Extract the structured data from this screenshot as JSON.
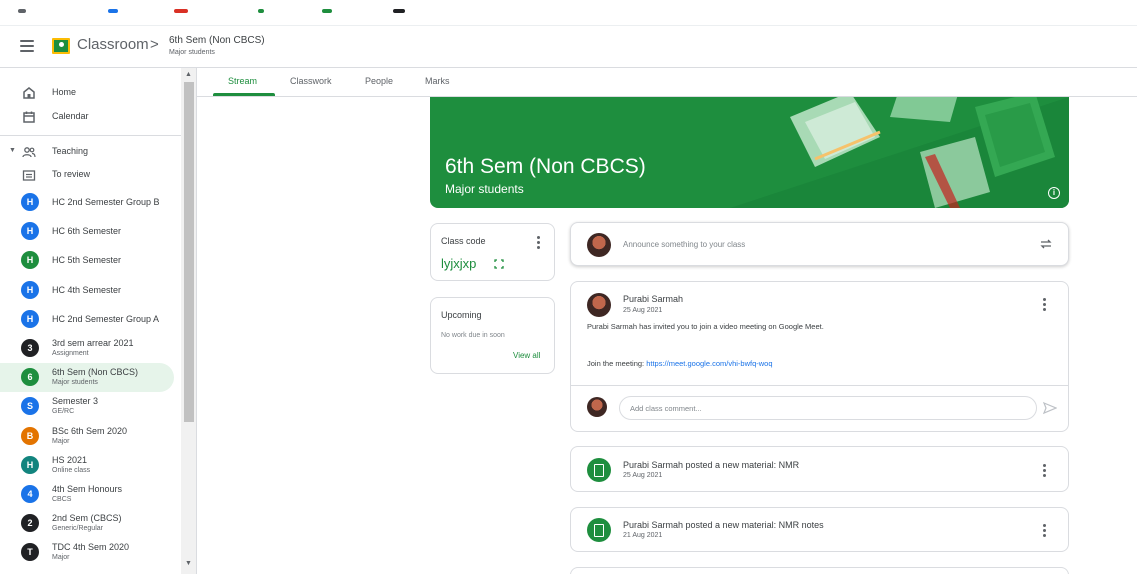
{
  "app": {
    "title": "Classroom"
  },
  "breadcrumb": {
    "separator": ">",
    "class_name": "6th Sem (Non CBCS)",
    "class_section": "Major students"
  },
  "sidebar": {
    "nav": [
      {
        "label": "Home",
        "icon": "home-icon"
      },
      {
        "label": "Calendar",
        "icon": "calendar-icon"
      }
    ],
    "teaching_label": "Teaching",
    "to_review_label": "To review",
    "classes": [
      {
        "avatar": "H",
        "name": "HC 2nd Semester Group B",
        "sub": "",
        "color": "#1a73e8"
      },
      {
        "avatar": "H",
        "name": "HC 6th Semester",
        "sub": "",
        "color": "#1a73e8"
      },
      {
        "avatar": "H",
        "name": "HC 5th Semester",
        "sub": "",
        "color": "#1e8e3e"
      },
      {
        "avatar": "H",
        "name": "HC 4th Semester",
        "sub": "",
        "color": "#1a73e8"
      },
      {
        "avatar": "H",
        "name": "HC 2nd Semester Group A",
        "sub": "",
        "color": "#1a73e8"
      },
      {
        "avatar": "3",
        "name": "3rd sem arrear 2021",
        "sub": "Assignment",
        "color": "#202124"
      },
      {
        "avatar": "6",
        "name": "6th Sem (Non CBCS)",
        "sub": "Major students",
        "color": "#1e8e3e"
      },
      {
        "avatar": "S",
        "name": "Semester 3",
        "sub": "GE/RC",
        "color": "#1a73e8"
      },
      {
        "avatar": "B",
        "name": "BSc 6th Sem 2020",
        "sub": "Major",
        "color": "#e37400"
      },
      {
        "avatar": "H",
        "name": "HS 2021",
        "sub": "Online class",
        "color": "#12847e"
      },
      {
        "avatar": "4",
        "name": "4th Sem Honours",
        "sub": "CBCS",
        "color": "#1a73e8"
      },
      {
        "avatar": "2",
        "name": "2nd Sem (CBCS)",
        "sub": "Generic/Regular",
        "color": "#202124"
      },
      {
        "avatar": "T",
        "name": "TDC 4th Sem 2020",
        "sub": "Major",
        "color": "#202124"
      }
    ]
  },
  "tabs": [
    "Stream",
    "Classwork",
    "People",
    "Marks"
  ],
  "banner": {
    "title": "6th Sem (Non CBCS)",
    "subtitle": "Major students"
  },
  "class_code": {
    "label": "Class code",
    "code": "lyjxjxp"
  },
  "upcoming": {
    "label": "Upcoming",
    "empty_text": "No work due in soon",
    "view_all": "View all"
  },
  "announce": {
    "placeholder": "Announce something to your class"
  },
  "post": {
    "author": "Purabi Sarmah",
    "date": "25 Aug 2021",
    "body": "Purabi Sarmah has invited you to join a video meeting on Google Meet.",
    "join_label": "Join the meeting: ",
    "link": "https://meet.google.com/vhi-bwfq-woq",
    "comment_placeholder": "Add class comment..."
  },
  "materials": [
    {
      "title": "Purabi Sarmah posted a new material: NMR",
      "date": "25 Aug 2021"
    },
    {
      "title": "Purabi Sarmah posted a new material: NMR notes",
      "date": "21 Aug 2021"
    }
  ],
  "colors": {
    "accent": "#1e8e3e",
    "link": "#1a73e8"
  }
}
